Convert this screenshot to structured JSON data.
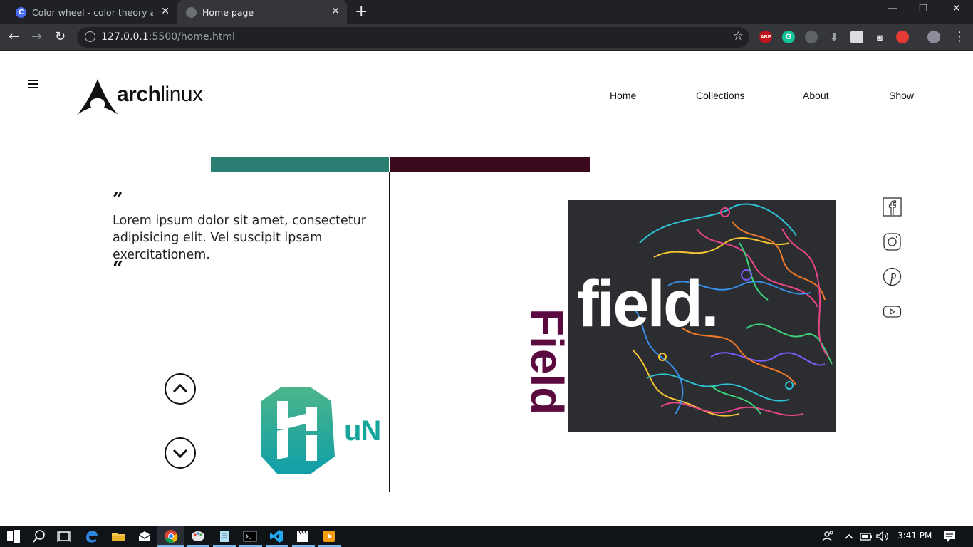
{
  "browser": {
    "tabs": [
      {
        "title": "Color wheel - color theory and c",
        "favicon": "C",
        "active": false
      },
      {
        "title": "Home page",
        "active": true
      }
    ],
    "url_host": "127.0.0.1",
    "url_rest": ":5500/home.html"
  },
  "site": {
    "logo_bold": "arch",
    "logo_light": "linux",
    "nav": {
      "home": "Home",
      "collections": "Collections",
      "about": "About",
      "show": "Show"
    },
    "quote": {
      "open_mark": "”",
      "text": "Lorem ipsum dolor sit amet, consectetur adipisicing elit. Vel suscipit ipsam exercitationem.",
      "close_mark": "“"
    },
    "hun_letters": "uN",
    "field_vertical": "Field",
    "field_card_word": "field.",
    "colors": {
      "teal": "#2a7f72",
      "maroon": "#3b0a1e",
      "field_purple": "#5b0a3f",
      "hun_teal": "#16a59a"
    },
    "social_icons": [
      "facebook-icon",
      "instagram-icon",
      "pinterest-icon",
      "youtube-icon"
    ]
  },
  "taskbar": {
    "time": "3:41 PM"
  }
}
